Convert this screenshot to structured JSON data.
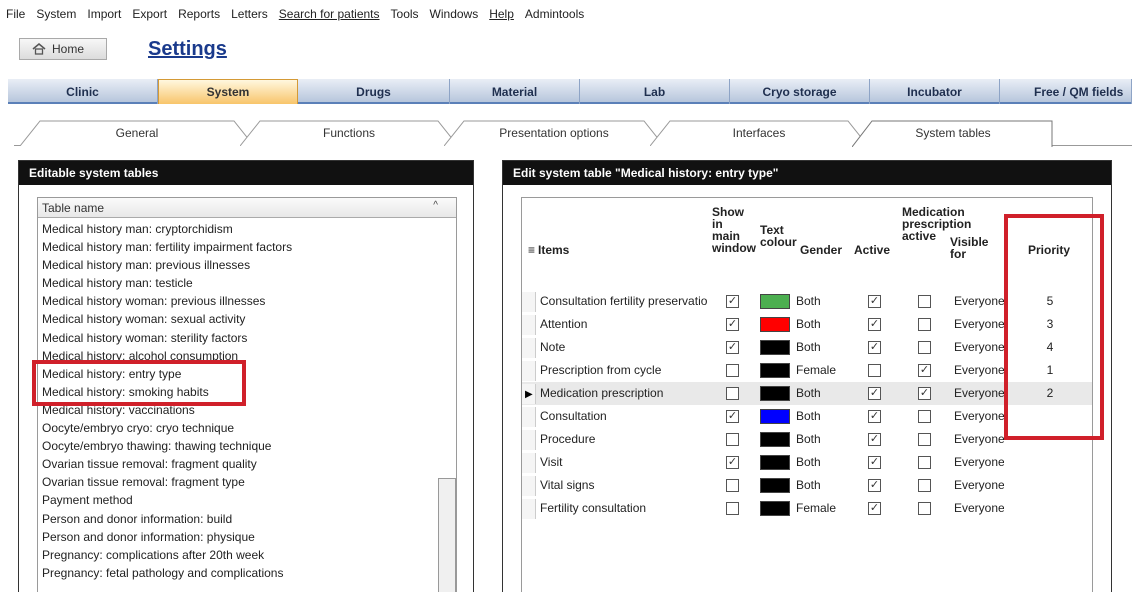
{
  "menu": [
    "File",
    "System",
    "Import",
    "Export",
    "Reports",
    "Letters",
    "Search for patients",
    "Tools",
    "Windows",
    "Help",
    "Admintools"
  ],
  "home_label": "Home",
  "page_title": "Settings",
  "main_tabs": [
    "Clinic",
    "System",
    "Drugs",
    "Material",
    "Lab",
    "Cryo storage",
    "Incubator",
    "Free / QM fields"
  ],
  "sub_tabs": [
    "General",
    "Functions",
    "Presentation options",
    "Interfaces",
    "System tables"
  ],
  "left_panel": {
    "title": "Editable system tables",
    "column_header": "Table name",
    "items": [
      "Medical history man: cryptorchidism",
      "Medical history man: fertility impairment factors",
      "Medical history man: previous illnesses",
      "Medical history man: testicle",
      "Medical history woman: previous illnesses",
      "Medical history woman: sexual activity",
      "Medical history woman: sterility factors",
      "Medical history: alcohol consumption",
      "Medical history: entry type",
      "Medical history: smoking habits",
      "Medical history: vaccinations",
      "Oocyte/embryo cryo: cryo technique",
      "Oocyte/embryo thawing: thawing technique",
      "Ovarian tissue removal: fragment quality",
      "Ovarian tissue removal: fragment type",
      "Payment method",
      "Person and donor information: build",
      "Person and donor information: physique",
      "Pregnancy: complications after 20th week",
      "Pregnancy: fetal pathology and complications"
    ]
  },
  "right_panel": {
    "title": "Edit system table \"Medical history: entry type\"",
    "headers": {
      "items": "Items",
      "show": "Show in main window",
      "text_colour": "Text colour",
      "gender": "Gender",
      "active": "Active",
      "medication": "Medication prescription active",
      "visible": "Visible for",
      "priority": "Priority"
    },
    "rows": [
      {
        "item": "Consultation fertility preservation",
        "show": true,
        "color": "#4caf50",
        "gender": "Both",
        "active": true,
        "med": false,
        "visible": "Everyone",
        "priority": "5"
      },
      {
        "item": "Attention",
        "show": true,
        "color": "#ff0000",
        "gender": "Both",
        "active": true,
        "med": false,
        "visible": "Everyone",
        "priority": "3"
      },
      {
        "item": "Note",
        "show": true,
        "color": "#000000",
        "gender": "Both",
        "active": true,
        "med": false,
        "visible": "Everyone",
        "priority": "4"
      },
      {
        "item": "Prescription from cycle",
        "show": false,
        "color": "#000000",
        "gender": "Female",
        "active": false,
        "med": true,
        "visible": "Everyone",
        "priority": "1"
      },
      {
        "item": "Medication prescription",
        "show": false,
        "color": "#000000",
        "gender": "Both",
        "active": true,
        "med": true,
        "visible": "Everyone",
        "priority": "2"
      },
      {
        "item": "Consultation",
        "show": true,
        "color": "#0000ff",
        "gender": "Both",
        "active": true,
        "med": false,
        "visible": "Everyone",
        "priority": ""
      },
      {
        "item": "Procedure",
        "show": false,
        "color": "#000000",
        "gender": "Both",
        "active": true,
        "med": false,
        "visible": "Everyone",
        "priority": ""
      },
      {
        "item": "Visit",
        "show": true,
        "color": "#000000",
        "gender": "Both",
        "active": true,
        "med": false,
        "visible": "Everyone",
        "priority": ""
      },
      {
        "item": "Vital signs",
        "show": false,
        "color": "#000000",
        "gender": "Both",
        "active": true,
        "med": false,
        "visible": "Everyone",
        "priority": ""
      },
      {
        "item": "Fertility consultation",
        "show": false,
        "color": "#000000",
        "gender": "Female",
        "active": true,
        "med": false,
        "visible": "Everyone",
        "priority": ""
      }
    ]
  },
  "colors": {
    "highlight": "#d0202a",
    "panel_header": "#111111",
    "active_tab": "#f8c56b",
    "title": "#1a3a8c"
  }
}
